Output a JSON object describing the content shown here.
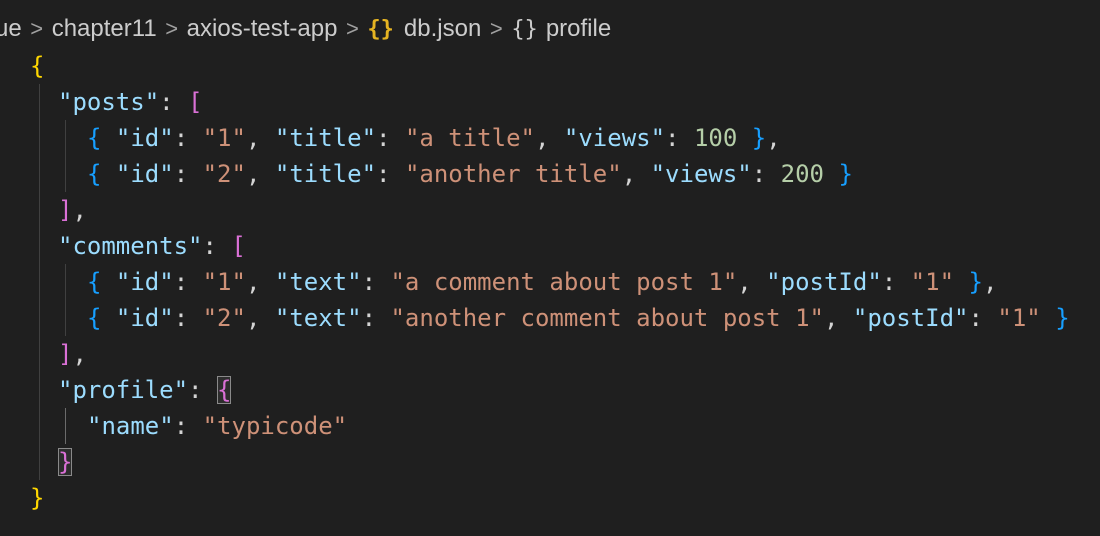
{
  "breadcrumb": {
    "items": [
      {
        "label": "ue"
      },
      {
        "label": "chapter11"
      },
      {
        "label": "axios-test-app"
      },
      {
        "label": "db.json",
        "icon": "json-file-icon"
      },
      {
        "label": "profile",
        "icon": "object-symbol-icon"
      }
    ],
    "separator": ">",
    "json_icon_glyph": "{}",
    "object_icon_glyph": "{}"
  },
  "editor": {
    "file": {
      "posts": [
        {
          "id": "1",
          "title": "a title",
          "views": "100"
        },
        {
          "id": "2",
          "title": "another title",
          "views": "200"
        }
      ],
      "comments": [
        {
          "id": "1",
          "text": "a comment about post 1",
          "postId": "1"
        },
        {
          "id": "2",
          "text": "another comment about post 1",
          "postId": "1"
        }
      ],
      "profile": {
        "name": "typicode"
      }
    },
    "keys": {
      "posts": "\"posts\"",
      "comments": "\"comments\"",
      "profile": "\"profile\"",
      "id": "\"id\"",
      "title": "\"title\"",
      "views": "\"views\"",
      "text": "\"text\"",
      "postId": "\"postId\"",
      "name": "\"name\""
    },
    "strings": {
      "posts_0_id": "\"1\"",
      "posts_0_title": "\"a title\"",
      "posts_1_id": "\"2\"",
      "posts_1_title": "\"another title\"",
      "comments_0_id": "\"1\"",
      "comments_0_text": "\"a comment about post 1\"",
      "comments_0_postId": "\"1\"",
      "comments_1_id": "\"2\"",
      "comments_1_text": "\"another comment about post 1\"",
      "comments_1_postId": "\"1\"",
      "profile_name": "\"typicode\""
    },
    "numbers": {
      "posts_0_views": "100",
      "posts_1_views": "200"
    },
    "colors": {
      "background": "#1f1f1f",
      "key": "#9cdcfe",
      "string": "#ce9178",
      "number": "#b5cea8",
      "brace_gold": "#ffd700",
      "brace_purple": "#da70d6",
      "brace_blue": "#179fff"
    }
  }
}
